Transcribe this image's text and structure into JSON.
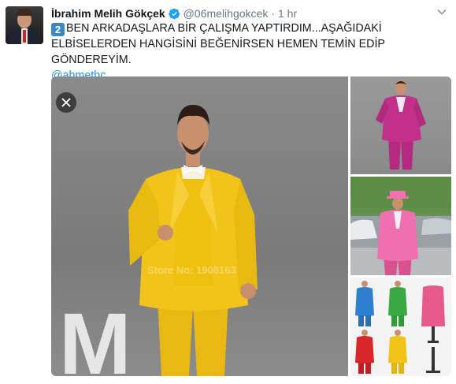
{
  "tweet": {
    "author_name": "İbrahim Melih Gökçek",
    "handle": "@06melihgokcek",
    "separator": "·",
    "time": "1 hr",
    "keycap": "2",
    "body_line1": "BEN ARKADAŞLARA BİR ÇALIŞMA YAPTIRDIM...AŞAĞIDAKİ",
    "body_line2": "ELBİSELERDEN HANGİSİNİ BEĞENİRSEN HEMEN TEMİN EDİP GÖNDEREYİM.",
    "mention": "@ahmethc",
    "verified": true
  },
  "media": {
    "watermark": "Store No: 1908163",
    "background_letters": "M",
    "photos": [
      {
        "name": "yellow-suit-photo",
        "suit_color": "#f2c318"
      },
      {
        "name": "magenta-suit-photo",
        "suit_color": "#c2308a"
      },
      {
        "name": "pink-suit-street-photo",
        "suit_color": "#ef6fb0"
      },
      {
        "name": "colored-suits-grid-photo",
        "suit_colors": [
          "#2f7fd1",
          "#3aa843",
          "#e55a8a",
          "#d9262a",
          "#f2c318"
        ]
      }
    ]
  },
  "icons": {
    "verified": "verified-badge-icon",
    "menu": "chevron-down-icon",
    "close": "close-icon"
  },
  "colors": {
    "link": "#1b95e0",
    "secondary_text": "#657786",
    "verified": "#1da1f2"
  }
}
